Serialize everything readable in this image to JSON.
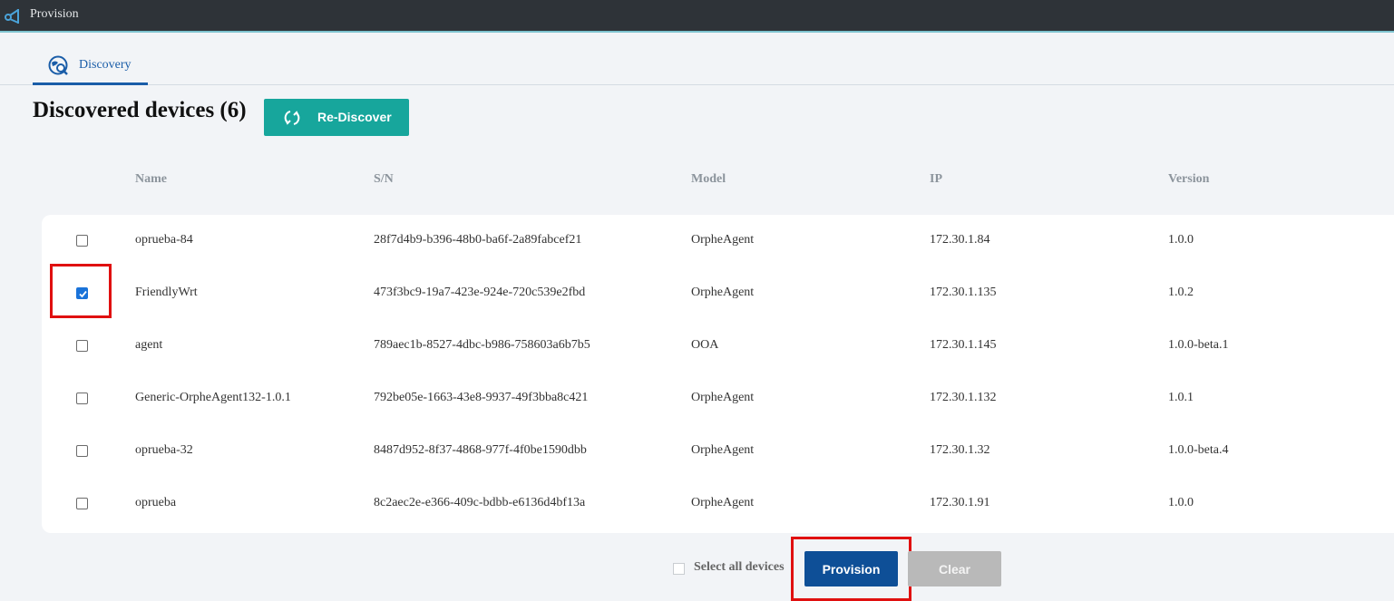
{
  "app": {
    "title": "Provision",
    "logo_icon": "share-nodes-icon"
  },
  "tabs": [
    {
      "label": "Discovery",
      "icon": "discovery-icon",
      "active": true
    }
  ],
  "main": {
    "heading": "Discovered devices (6)",
    "rediscover_label": "Re-Discover",
    "rediscover_icon": "refresh-icon"
  },
  "table": {
    "headers": [
      "Name",
      "S/N",
      "Model",
      "IP",
      "Version"
    ],
    "rows": [
      {
        "checked": false,
        "name": "oprueba-84",
        "sn": "28f7d4b9-b396-48b0-ba6f-2a89fabcef21",
        "model": "OrpheAgent",
        "ip": "172.30.1.84",
        "version": "1.0.0"
      },
      {
        "checked": true,
        "name": "FriendlyWrt",
        "sn": "473f3bc9-19a7-423e-924e-720c539e2fbd",
        "model": "OrpheAgent",
        "ip": "172.30.1.135",
        "version": "1.0.2"
      },
      {
        "checked": false,
        "name": "agent",
        "sn": "789aec1b-8527-4dbc-b986-758603a6b7b5",
        "model": "OOA",
        "ip": "172.30.1.145",
        "version": "1.0.0-beta.1"
      },
      {
        "checked": false,
        "name": "Generic-OrpheAgent132-1.0.1",
        "sn": "792be05e-1663-43e8-9937-49f3bba8c421",
        "model": "OrpheAgent",
        "ip": "172.30.1.132",
        "version": "1.0.1"
      },
      {
        "checked": false,
        "name": "oprueba-32",
        "sn": "8487d952-8f37-4868-977f-4f0be1590dbb",
        "model": "OrpheAgent",
        "ip": "172.30.1.32",
        "version": "1.0.0-beta.4"
      },
      {
        "checked": false,
        "name": "oprueba",
        "sn": "8c2aec2e-e366-409c-bdbb-e6136d4bf13a",
        "model": "OrpheAgent",
        "ip": "172.30.1.91",
        "version": "1.0.0"
      }
    ]
  },
  "footer": {
    "select_all_label": "Select all devices",
    "select_all_checked": false,
    "provision_label": "Provision",
    "clear_label": "Clear"
  },
  "colors": {
    "accent": "#1a5da8",
    "rediscover": "#17a69c",
    "provision": "#0e4f97",
    "clear_disabled": "#b9b9b9",
    "highlight": "#e01010"
  }
}
